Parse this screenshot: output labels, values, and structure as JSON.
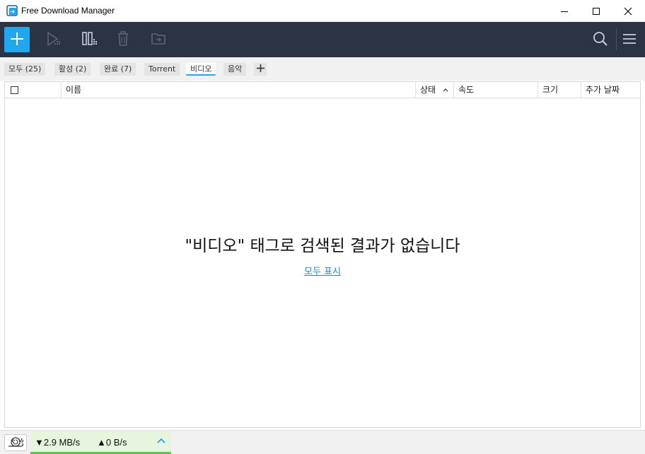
{
  "window": {
    "title": "Free Download Manager",
    "controls": [
      "minimize",
      "maximize",
      "close"
    ]
  },
  "toolbar": {
    "buttons": [
      {
        "name": "add",
        "icon": "plus-icon"
      },
      {
        "name": "resume",
        "icon": "play-icon"
      },
      {
        "name": "pause",
        "icon": "pause-icon"
      },
      {
        "name": "delete",
        "icon": "trash-icon"
      },
      {
        "name": "open-folder",
        "icon": "folder-icon"
      },
      {
        "name": "search",
        "icon": "search-icon"
      },
      {
        "name": "menu",
        "icon": "hamburger-icon"
      }
    ],
    "accent": "#22a6f0",
    "background": "#2b3445"
  },
  "tags": {
    "items": [
      {
        "label": "모두 (25)"
      },
      {
        "label": "활성 (2)"
      },
      {
        "label": "완료 (7)"
      },
      {
        "label": "Torrent"
      },
      {
        "label": "비디오",
        "active": true
      },
      {
        "label": "음악"
      }
    ],
    "add_label": "+"
  },
  "table": {
    "columns": [
      "이름",
      "상태",
      "속도",
      "크기",
      "추가 날짜"
    ],
    "sorted_by": "상태",
    "sort_direction": "ascending"
  },
  "empty_state": {
    "message": "\"비디오\" 태그로 검색된 결과가 없습니다",
    "link": "모두 표시"
  },
  "status": {
    "download_speed": "▼2.9 MB/s",
    "upload_speed": "▲0 B/s",
    "speed_bar_color": "#62c251"
  }
}
